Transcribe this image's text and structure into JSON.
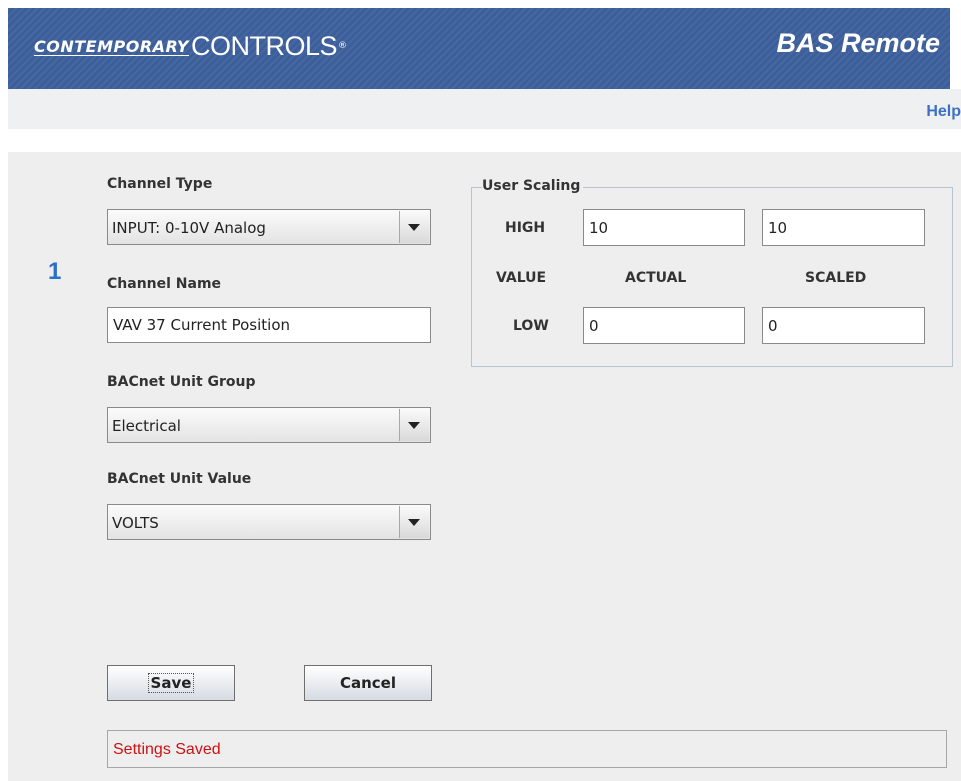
{
  "header": {
    "logo_word1": "CONTEMPORARY",
    "logo_word2": "CONTROLS",
    "logo_mark": "®",
    "title": "BAS Remote",
    "bg_color": "#3c5f9b"
  },
  "helpbar": {
    "help_label": "Help"
  },
  "channel": {
    "number": "1"
  },
  "form": {
    "channel_type_label": "Channel Type",
    "channel_type_value": "INPUT: 0-10V Analog",
    "channel_name_label": "Channel Name",
    "channel_name_value": "VAV 37 Current Position",
    "unit_group_label": "BACnet Unit Group",
    "unit_group_value": "Electrical",
    "unit_value_label": "BACnet Unit Value",
    "unit_value_value": "VOLTS"
  },
  "scaling": {
    "legend": "User Scaling",
    "high_label": "HIGH",
    "value_label": "VALUE",
    "actual_label": "ACTUAL",
    "scaled_label": "SCALED",
    "low_label": "LOW",
    "high_actual": "10",
    "high_scaled": "10",
    "low_actual": "0",
    "low_scaled": "0"
  },
  "buttons": {
    "save": "Save",
    "cancel": "Cancel"
  },
  "status": {
    "message": "Settings Saved",
    "color": "#cc1111"
  }
}
